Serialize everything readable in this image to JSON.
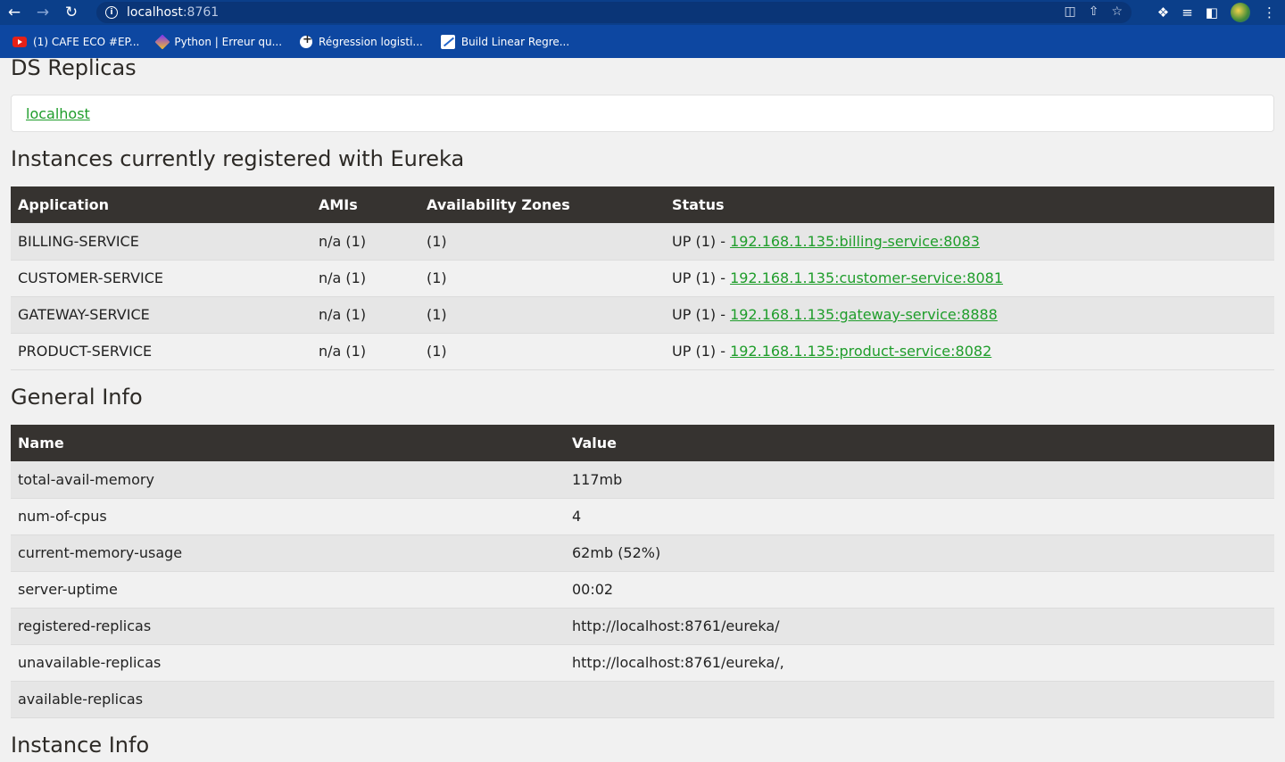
{
  "browser": {
    "url_host": "localhost",
    "url_port": ":8761",
    "bookmarks": [
      {
        "label": "(1) CAFE ECO #EP...",
        "icon": "youtube-icon"
      },
      {
        "label": "Python | Erreur qu...",
        "icon": "python-icon"
      },
      {
        "label": "Régression logisti...",
        "icon": "puzzle-icon"
      },
      {
        "label": "Build Linear Regre...",
        "icon": "chart-icon"
      }
    ]
  },
  "ds_replicas": {
    "title": "DS Replicas",
    "link": "localhost"
  },
  "instances": {
    "title": "Instances currently registered with Eureka",
    "headers": [
      "Application",
      "AMIs",
      "Availability Zones",
      "Status"
    ],
    "rows": [
      {
        "app": "BILLING-SERVICE",
        "amis": "n/a (1)",
        "zones": "(1)",
        "status_prefix": "UP (1) - ",
        "status_link": "192.168.1.135:billing-service:8083"
      },
      {
        "app": "CUSTOMER-SERVICE",
        "amis": "n/a (1)",
        "zones": "(1)",
        "status_prefix": "UP (1) - ",
        "status_link": "192.168.1.135:customer-service:8081"
      },
      {
        "app": "GATEWAY-SERVICE",
        "amis": "n/a (1)",
        "zones": "(1)",
        "status_prefix": "UP (1) - ",
        "status_link": "192.168.1.135:gateway-service:8888"
      },
      {
        "app": "PRODUCT-SERVICE",
        "amis": "n/a (1)",
        "zones": "(1)",
        "status_prefix": "UP (1) - ",
        "status_link": "192.168.1.135:product-service:8082"
      }
    ]
  },
  "general_info": {
    "title": "General Info",
    "headers": [
      "Name",
      "Value"
    ],
    "rows": [
      {
        "name": "total-avail-memory",
        "value": "117mb"
      },
      {
        "name": "num-of-cpus",
        "value": "4"
      },
      {
        "name": "current-memory-usage",
        "value": "62mb (52%)"
      },
      {
        "name": "server-uptime",
        "value": "00:02"
      },
      {
        "name": "registered-replicas",
        "value": "http://localhost:8761/eureka/"
      },
      {
        "name": "unavailable-replicas",
        "value": "http://localhost:8761/eureka/,"
      },
      {
        "name": "available-replicas",
        "value": ""
      }
    ]
  },
  "instance_info": {
    "title": "Instance Info"
  }
}
